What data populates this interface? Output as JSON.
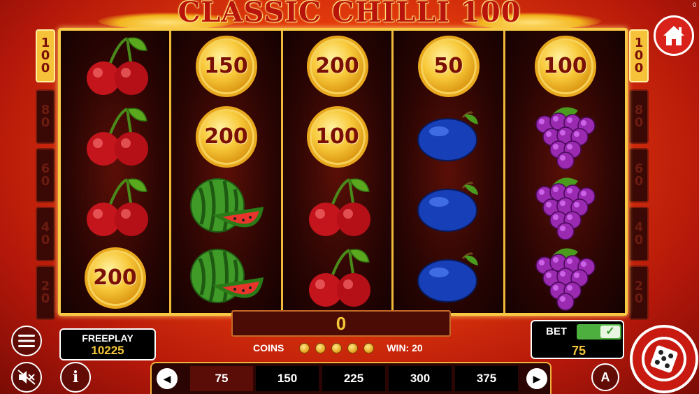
{
  "title": "CLASSIC CHILLI 100",
  "version": "0",
  "side_multipliers": {
    "left": [
      {
        "label": "100",
        "digits": [
          "1",
          "0",
          "0"
        ],
        "active": true
      },
      {
        "label": "80",
        "digits": [
          "8",
          "0"
        ],
        "active": false
      },
      {
        "label": "60",
        "digits": [
          "6",
          "0"
        ],
        "active": false
      },
      {
        "label": "40",
        "digits": [
          "4",
          "0"
        ],
        "active": false
      },
      {
        "label": "20",
        "digits": [
          "2",
          "0"
        ],
        "active": false
      }
    ],
    "right": [
      {
        "label": "100",
        "digits": [
          "1",
          "0",
          "0"
        ],
        "active": true
      },
      {
        "label": "80",
        "digits": [
          "8",
          "0"
        ],
        "active": false
      },
      {
        "label": "60",
        "digits": [
          "6",
          "0"
        ],
        "active": false
      },
      {
        "label": "40",
        "digits": [
          "4",
          "0"
        ],
        "active": false
      },
      {
        "label": "20",
        "digits": [
          "2",
          "0"
        ],
        "active": false
      }
    ]
  },
  "reels": [
    [
      "cherry",
      "cherry",
      "cherry",
      "coin:200"
    ],
    [
      "coin:150",
      "coin:200",
      "watermelon",
      "watermelon"
    ],
    [
      "coin:200",
      "coin:100",
      "cherry",
      "cherry"
    ],
    [
      "coin:50",
      "plum",
      "plum",
      "plum"
    ],
    [
      "coin:100",
      "grapes",
      "grapes",
      "grapes"
    ]
  ],
  "win_display": "0",
  "coins_label": "COINS",
  "coins_count": 5,
  "win_label": "WIN: 20",
  "freeplay": {
    "label": "FREEPLAY",
    "value": "10225"
  },
  "bet": {
    "label": "BET",
    "value": "75",
    "toggle_on": true
  },
  "bet_options": [
    "75",
    "150",
    "225",
    "300",
    "375"
  ],
  "bet_selected_index": 0,
  "colors": {
    "accent_gold": "#f6c63a",
    "reel_border": "#f0b93a",
    "button_red": "#c81a10"
  },
  "icons": {
    "home": "home-icon",
    "menu": "menu-icon",
    "sound": "sound-muted-icon",
    "info": "info-icon",
    "autoplay": "autoplay-icon",
    "spin": "spin-icon",
    "prev": "chevron-left-icon",
    "next": "chevron-right-icon"
  }
}
